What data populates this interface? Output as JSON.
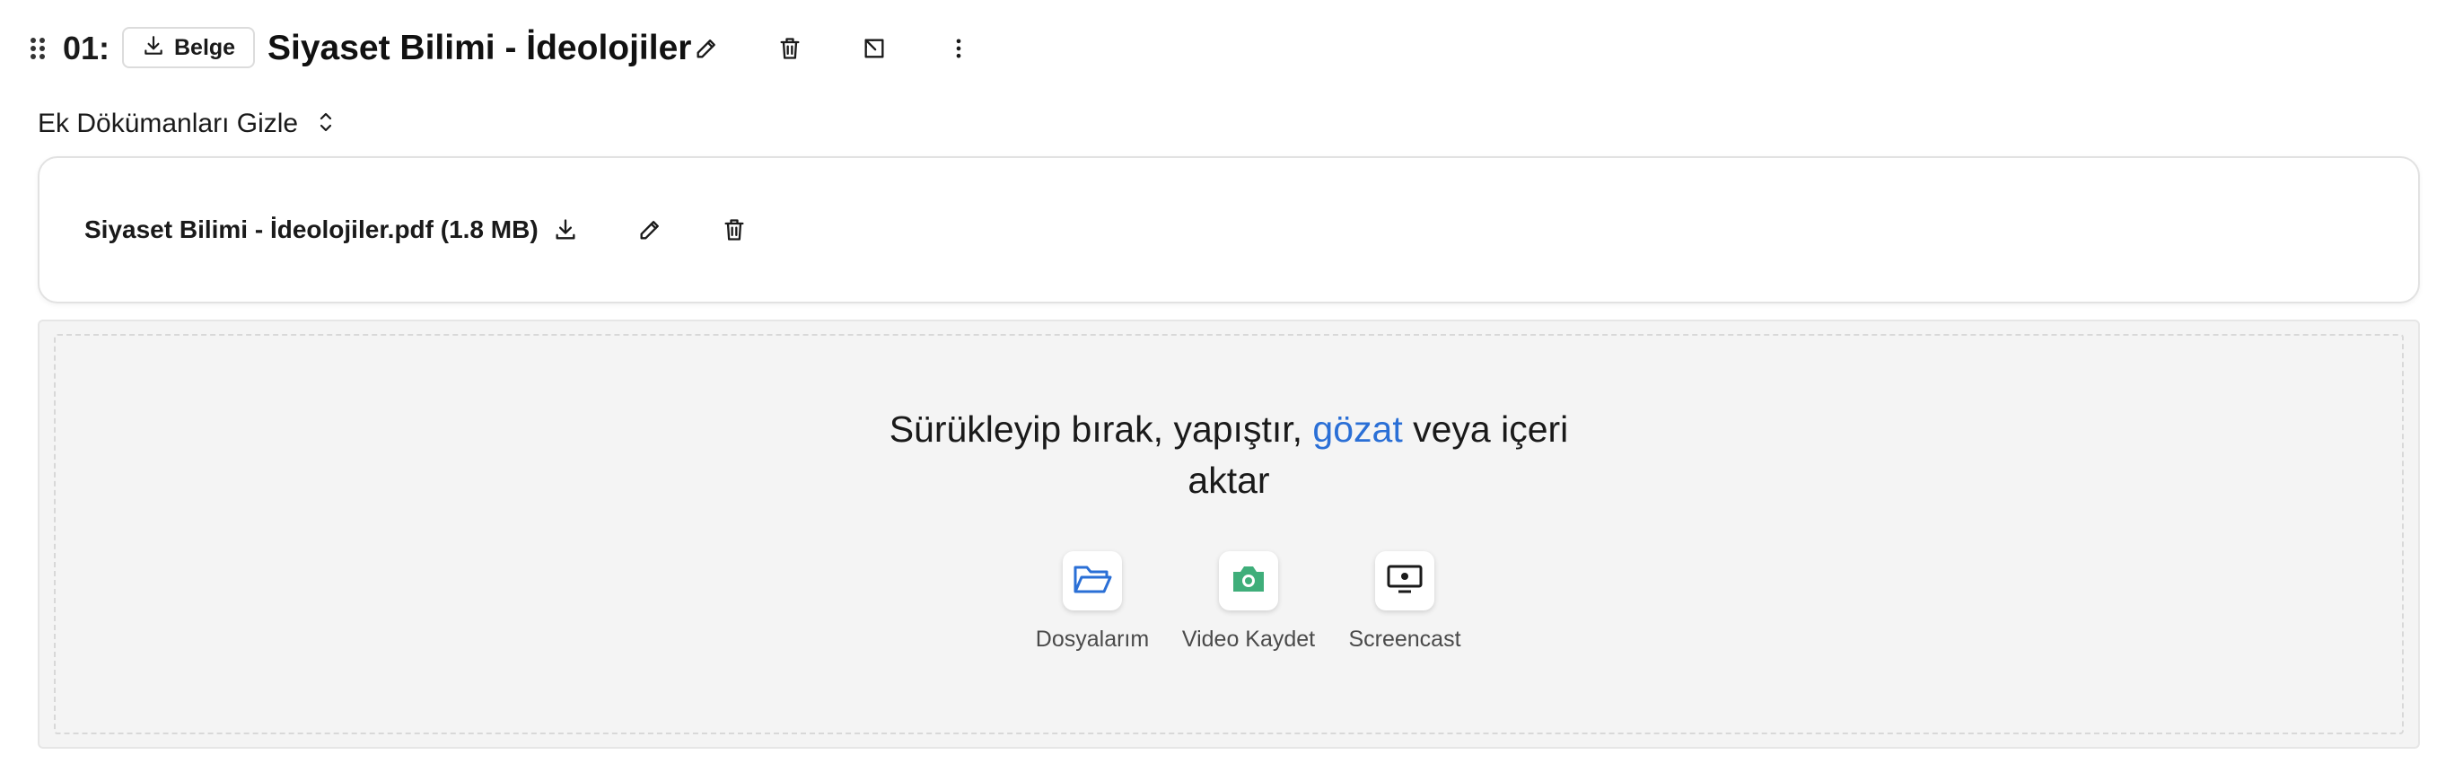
{
  "lecture": {
    "number": "01:",
    "type_label": "Belge",
    "title": "Siyaset Bilimi - İdeolojiler"
  },
  "attachments": {
    "toggle_label": "Ek Dökümanları Gizle",
    "file_name": "Siyaset Bilimi - İdeolojiler.pdf (1.8 MB)"
  },
  "dropzone": {
    "text_before": "Sürükleyip bırak, yapıştır, ",
    "browse_link": "gözat",
    "text_after": " veya içeri",
    "text_line2": "aktar",
    "sources": {
      "my_files": "Dosyalarım",
      "record_video": "Video Kaydet",
      "screencast": "Screencast"
    }
  },
  "icons": {
    "drag": "drag-handle-icon",
    "download": "download-icon",
    "edit": "pencil-icon",
    "delete": "trash-icon",
    "open": "arrow-up-left-box-icon",
    "more": "more-vertical-icon",
    "sort": "chevron-up-down-icon",
    "folder": "folder-open-icon",
    "camera": "camera-icon",
    "screen": "monitor-icon"
  },
  "colors": {
    "link": "#2a6fd6",
    "folder": "#2a6fd6",
    "camera": "#3fae7a",
    "screen": "#1a1a1a"
  }
}
